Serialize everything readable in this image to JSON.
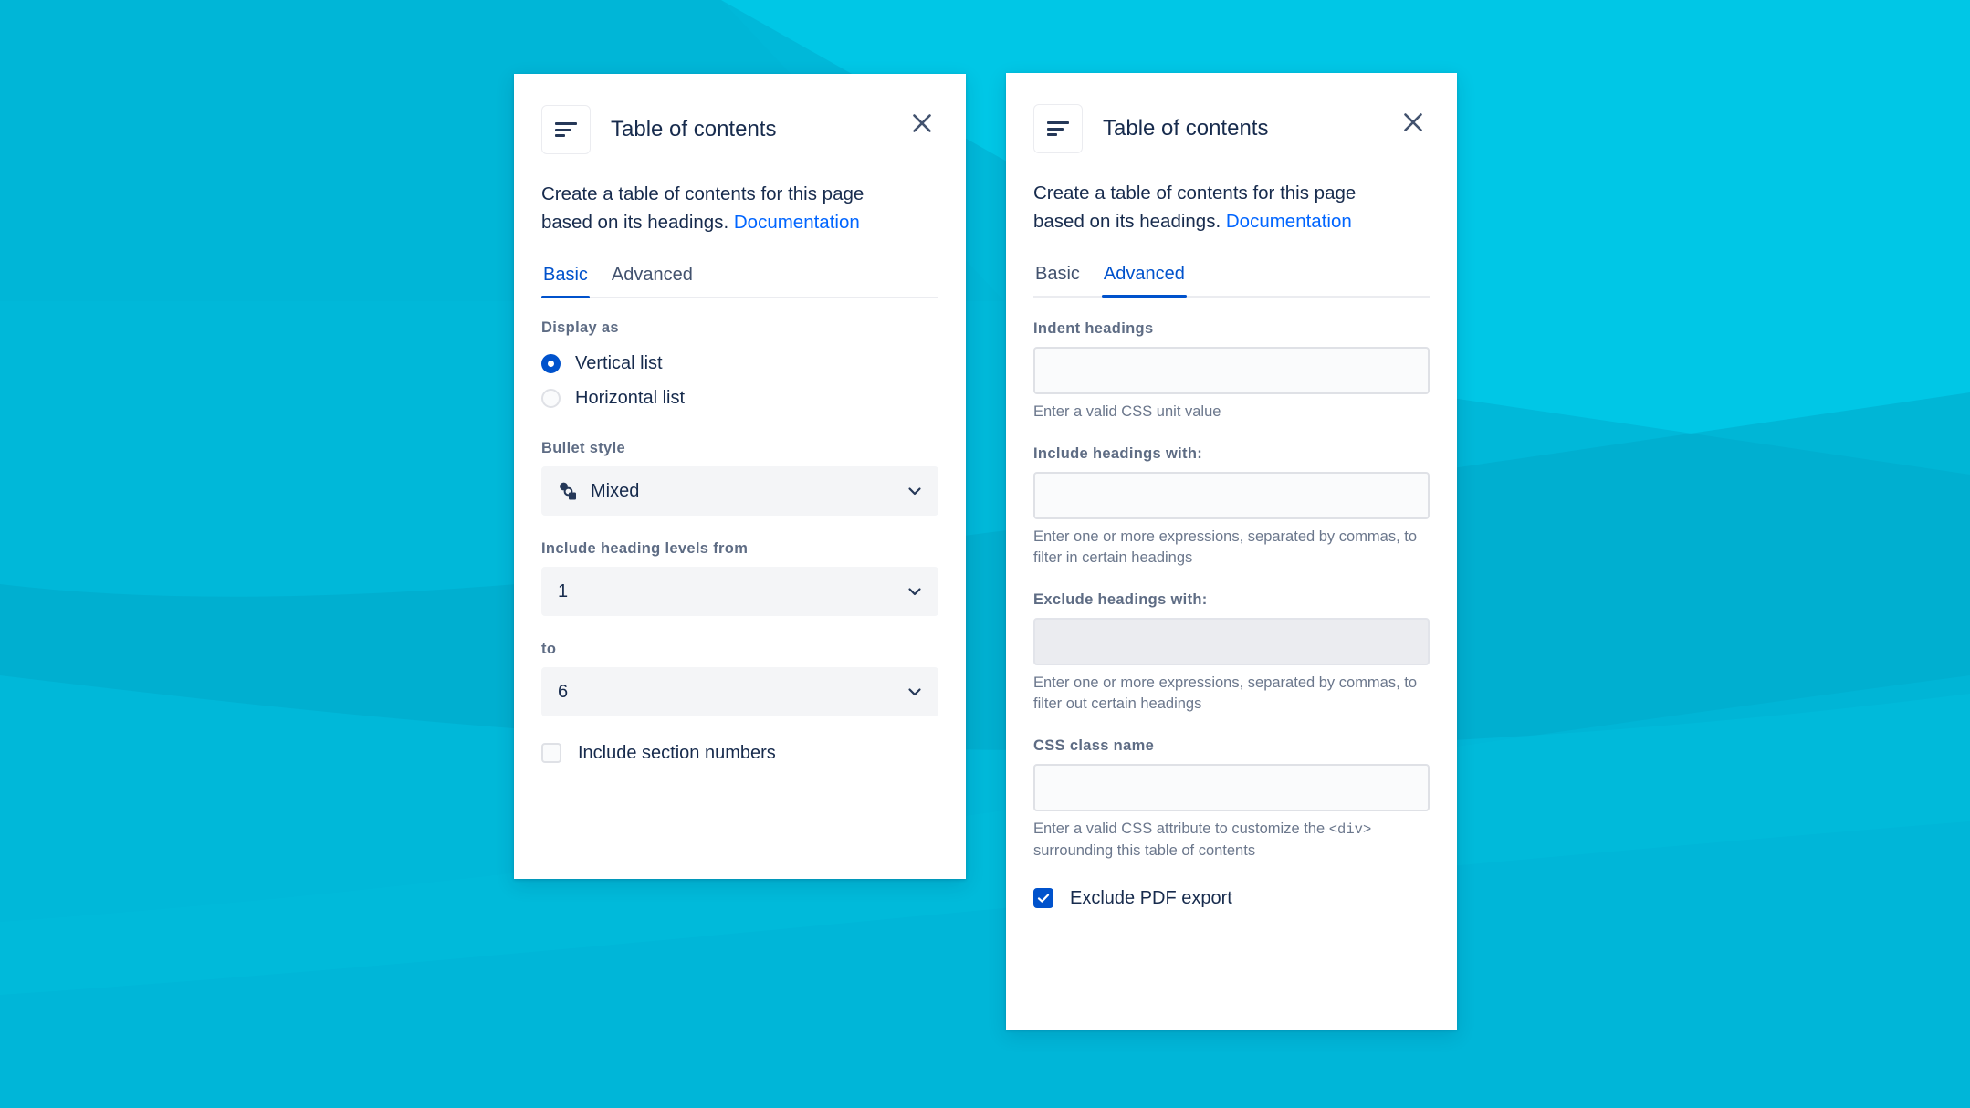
{
  "background": {
    "base_color": "#00b8d9",
    "band_colors": [
      "#00c7e6",
      "#00b2d4",
      "#00a8c9",
      "#00bcdc"
    ]
  },
  "theme": {
    "accent_blue": "#0052cc",
    "link_blue": "#0065ff",
    "text_dark": "#172b4d",
    "label_grey": "#5e6c84",
    "help_grey": "#6b778c",
    "field_grey": "#f4f5f7",
    "border_grey": "#dfe1e6"
  },
  "panel_basic": {
    "icon_name": "table-of-contents-icon",
    "title": "Table of contents",
    "close_label": "Close",
    "description_prefix": "Create a table of contents for this page based on its headings. ",
    "description_link": "Documentation",
    "tabs": [
      {
        "label": "Basic",
        "active": true
      },
      {
        "label": "Advanced",
        "active": false
      }
    ],
    "display_as": {
      "label": "Display as",
      "options": [
        {
          "label": "Vertical list",
          "selected": true
        },
        {
          "label": "Horizontal list",
          "selected": false
        }
      ]
    },
    "bullet_style": {
      "label": "Bullet style",
      "value": "Mixed",
      "icon_name": "mixed-bullet-icon"
    },
    "levels_from": {
      "label": "Include heading levels from",
      "value": "1"
    },
    "levels_to": {
      "label": "to",
      "value": "6"
    },
    "include_section_numbers": {
      "label": "Include section numbers",
      "checked": false
    }
  },
  "panel_advanced": {
    "icon_name": "table-of-contents-icon",
    "title": "Table of contents",
    "close_label": "Close",
    "description_prefix": "Create a table of contents for this page based on its headings. ",
    "description_link": "Documentation",
    "tabs": [
      {
        "label": "Basic",
        "active": false
      },
      {
        "label": "Advanced",
        "active": true
      }
    ],
    "indent_headings": {
      "label": "Indent headings",
      "value": "",
      "placeholder": "",
      "help": "Enter a valid CSS unit value"
    },
    "include_headings": {
      "label": "Include headings with:",
      "value": "",
      "placeholder": "",
      "help": "Enter one or more expressions, separated by commas, to filter in certain headings"
    },
    "exclude_headings": {
      "label": "Exclude headings with:",
      "value": "",
      "placeholder": "",
      "help": "Enter one or more expressions, separated by commas, to filter out certain headings"
    },
    "css_class_name": {
      "label": "CSS class name",
      "value": "",
      "placeholder": "",
      "help_before": "Enter a valid CSS attribute to customize the ",
      "help_code": "<div>",
      "help_after": " surrounding this table of contents"
    },
    "exclude_pdf_export": {
      "label": "Exclude PDF export",
      "checked": true
    }
  }
}
